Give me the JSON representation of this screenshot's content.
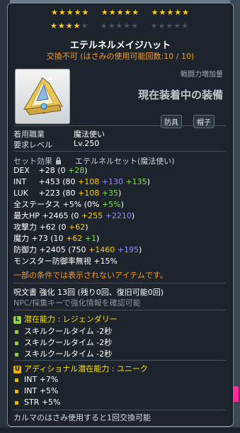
{
  "stars": {
    "row1": [
      "★★★★★",
      "★★★★★",
      "★★★★★"
    ],
    "row2_on": "★★★★",
    "row2_off": [
      "★",
      "★★★★★",
      "★★★★★"
    ]
  },
  "item": {
    "name": "エテルネルメイジハット",
    "trade_note": "交換不可 (はさみの使用可能回数:10 / 10)",
    "attack_label": "戦闘力増加量",
    "equipped_label": "現在装着中の装備",
    "tags": [
      "防具",
      "帽子"
    ]
  },
  "requirements": [
    {
      "label": "着用職業",
      "value": "魔法使い"
    },
    {
      "label": "要求レベル",
      "value": "Lv.250"
    }
  ],
  "set": {
    "label": "セット効果",
    "name": "エテルネルセット(魔法使い)"
  },
  "stats": [
    {
      "name": "DEX",
      "base": "+28",
      "paren_open": "(0 ",
      "p1": "+28",
      "p2": "",
      "p3": "",
      "paren_close": ")"
    },
    {
      "name": "INT",
      "base": "+453",
      "paren_open": "(80 ",
      "p1": "+108",
      "p2": " +130",
      "p3": " +135",
      "paren_close": ")"
    },
    {
      "name": "LUK",
      "base": "+223",
      "paren_open": "(80 ",
      "p1": "+108",
      "p2": "",
      "p3": " +35",
      "paren_close": ")"
    },
    {
      "name": "全ステータス",
      "base": "+5%",
      "paren_open": "(0% ",
      "p1": "",
      "p2": "",
      "p3": "+5%",
      "paren_close": ")"
    },
    {
      "name": "最大HP",
      "base": "+2465",
      "paren_open": "(0 ",
      "p1": "+255",
      "p2": " +2210",
      "p3": "",
      "paren_close": ")"
    },
    {
      "name": "攻撃力",
      "base": "+62",
      "paren_open": "(0 ",
      "p1": "+62",
      "p2": "",
      "p3": "",
      "paren_close": ")"
    },
    {
      "name": "魔力",
      "base": "+73",
      "paren_open": "(10 ",
      "p1": "+62",
      "p2": "",
      "p3": " +1",
      "paren_close": ")"
    },
    {
      "name": "防御力",
      "base": "+2405",
      "paren_open": "(750 ",
      "p1": "+1460",
      "p2": " +195",
      "p3": "",
      "paren_close": ")"
    },
    {
      "name": "モンスター防御率無視",
      "base": "+15%",
      "paren_open": "",
      "p1": "",
      "p2": "",
      "p3": "",
      "paren_close": ""
    }
  ],
  "warning": "一部の条件では表示されないアイテムです。",
  "scroll_text": "呪文書 強化 13回 (残り0回、復旧可能0回)",
  "npc_text": "NPC/採集キーで強化情報を確認可能",
  "potential": {
    "title": "潜在能力 : レジェンダリー",
    "icon": "L",
    "lines": [
      "スキルクールタイム -2秒",
      "スキルクールタイム -2秒",
      "スキルクールタイム -2秒"
    ]
  },
  "additional": {
    "title": "アディショナル潜在能力 : ユニーク",
    "icon": "U",
    "lines": [
      "INT +7%",
      "INT +5%",
      "STR +5%"
    ]
  },
  "footer": "カルマのはさみ使用すると1回交換可能",
  "icons": {
    "item": "eternel-mage-hat-icon",
    "lock": "lock-icon"
  }
}
